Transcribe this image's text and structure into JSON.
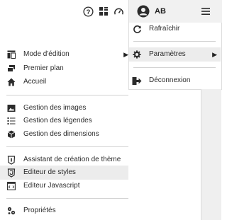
{
  "toolbar": {
    "help_icon": "help-circle-icon",
    "grid_icon": "grid-icon",
    "gauge_icon": "gauge-icon",
    "save_icon": "save-icon"
  },
  "user": {
    "initials": "AB",
    "avatar_icon": "user-avatar-icon",
    "menu_icon": "hamburger-icon"
  },
  "user_menu": {
    "refresh": "Rafraîchir",
    "settings": "Paramètres",
    "logout": "Déconnexion"
  },
  "left_menu": {
    "groups": [
      [
        {
          "label": "Mode d'édition",
          "icon": "edit-mode-icon",
          "submenu": true
        },
        {
          "label": "Premier plan",
          "icon": "foreground-icon"
        },
        {
          "label": "Accueil",
          "icon": "home-icon"
        }
      ],
      [
        {
          "label": "Gestion des images",
          "icon": "image-icon"
        },
        {
          "label": "Gestion des légendes",
          "icon": "list-icon"
        },
        {
          "label": "Gestion des dimensions",
          "icon": "cube-icon"
        }
      ],
      [
        {
          "label": "Assistant de création de thème",
          "icon": "shield-icon"
        },
        {
          "label": "Editeur de styles",
          "icon": "shield-css-icon",
          "highlighted": true
        },
        {
          "label": "Editeur Javascript",
          "icon": "code-window-icon"
        }
      ],
      [
        {
          "label": "Propriétés",
          "icon": "properties-icon"
        }
      ]
    ]
  },
  "colors": {
    "highlight": "#ececec",
    "separator": "#d3d3d3",
    "icon": "#2b2b2b"
  }
}
